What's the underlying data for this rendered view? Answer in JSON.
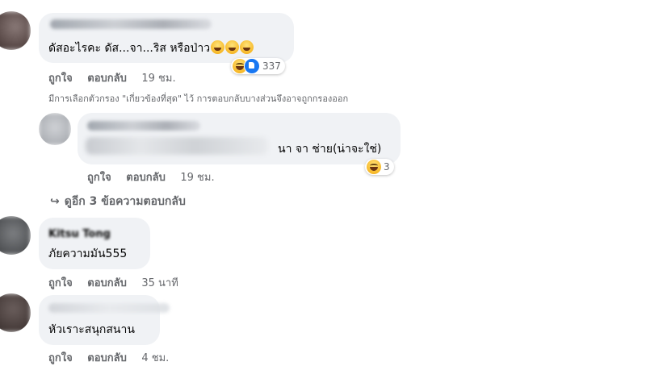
{
  "comments": [
    {
      "text": "ดัสอะไรคะ ดัส...จา...ริส หรือป่าว",
      "actions": {
        "like": "ถูกใจ",
        "reply": "ตอบกลับ",
        "time": "19 ชม."
      },
      "reaction_count": "337",
      "reaction_icons": [
        "haha-icon",
        "like-icon"
      ]
    },
    {
      "text": "นา จา ช่าย(น่าจะใช่)",
      "actions": {
        "like": "ถูกใจ",
        "reply": "ตอบกลับ",
        "time": "19 ชม."
      },
      "reaction_count": "3",
      "reaction_icons": [
        "haha-icon"
      ]
    },
    {
      "name": "Kitsu Tong",
      "text": "ภัยความมัน555",
      "actions": {
        "like": "ถูกใจ",
        "reply": "ตอบกลับ",
        "time": "35 นาที"
      }
    },
    {
      "text": "หัวเราะสนุกสนาน",
      "actions": {
        "like": "ถูกใจ",
        "reply": "ตอบกลับ",
        "time": "4 ชม."
      }
    }
  ],
  "filter_note": "มีการเลือกตัวกรอง \"เกี่ยวข้องที่สุด\" ไว้ การตอบกลับบางส่วนจึงอาจถูกกรองออก",
  "more_replies": "ดูอีก 3 ข้อความตอบกลับ",
  "colors": {
    "bubble": "#f0f2f5",
    "muted": "#65676b",
    "like_blue": "#1877f2",
    "haha_yellow": "#f7b928"
  }
}
